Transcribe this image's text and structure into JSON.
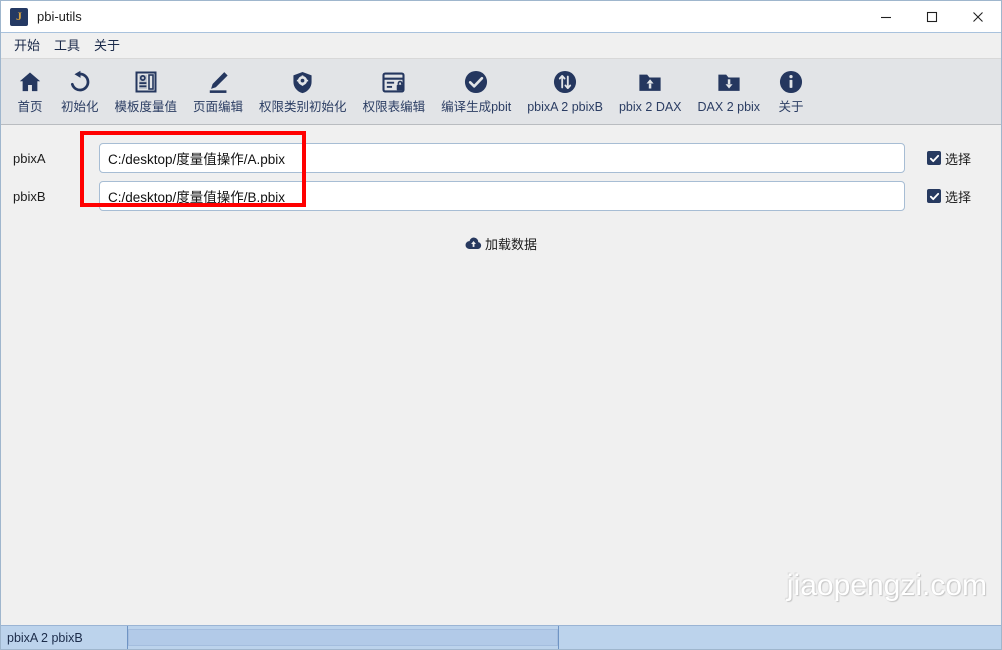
{
  "window": {
    "title": "pbi-utils",
    "app_icon_letter": "J",
    "controls": {
      "minimize": "minimize-icon",
      "maximize": "maximize-icon",
      "close": "close-icon"
    }
  },
  "menubar": {
    "items": [
      {
        "label": "开始",
        "name": "menu-start"
      },
      {
        "label": "工具",
        "name": "menu-tools"
      },
      {
        "label": "关于",
        "name": "menu-about"
      }
    ]
  },
  "toolbar": {
    "buttons": [
      {
        "label": "首页",
        "icon": "home-icon",
        "name": "toolbar-home"
      },
      {
        "label": "初始化",
        "icon": "refresh-icon",
        "name": "toolbar-initialize"
      },
      {
        "label": "模板度量值",
        "icon": "template-measure-icon",
        "name": "toolbar-template-measure"
      },
      {
        "label": "页面编辑",
        "icon": "pencil-edit-icon",
        "name": "toolbar-page-edit"
      },
      {
        "label": "权限类别初始化",
        "icon": "shield-gear-icon",
        "name": "toolbar-permission-category-init"
      },
      {
        "label": "权限表编辑",
        "icon": "table-lock-icon",
        "name": "toolbar-permission-table-edit"
      },
      {
        "label": "编译生成pbit",
        "icon": "check-circle-icon",
        "name": "toolbar-compile-pbit"
      },
      {
        "label": "pbixA 2 pbixB",
        "icon": "swap-arrows-circle-icon",
        "name": "toolbar-pbixa-2-pbixb"
      },
      {
        "label": "pbix 2 DAX",
        "icon": "folder-upload-icon",
        "name": "toolbar-pbix-2-dax"
      },
      {
        "label": "DAX 2 pbix",
        "icon": "folder-download-icon",
        "name": "toolbar-dax-2-pbix"
      },
      {
        "label": "关于",
        "icon": "info-circle-icon",
        "name": "toolbar-about"
      }
    ]
  },
  "main": {
    "fields": [
      {
        "label": "pbixA",
        "value": "C:/desktop/度量值操作/A.pbix",
        "placeholder": "",
        "checkbox_label": "选择",
        "checked": true
      },
      {
        "label": "pbixB",
        "value": "C:/desktop/度量值操作/B.pbix",
        "placeholder": "",
        "checkbox_label": "选择",
        "checked": true
      }
    ],
    "load_button": {
      "label": "加载数据",
      "icon": "cloud-upload-icon"
    },
    "annotation": {
      "type": "red-rectangle-highlight",
      "color": "#ff0000"
    },
    "watermark": "jiaopengzi.com"
  },
  "statusbar": {
    "mode_label": "pbixA 2 pbixB",
    "progress_value": ""
  },
  "colors": {
    "accent": "#25375f",
    "toolbar_bg": "#e2e4e7",
    "body_bg": "#f0f0f0",
    "statusbar_bg": "#bcd3ec",
    "annotation_red": "#ff0000",
    "checkbox_fill": "#273a60",
    "input_border": "#a7bdd4",
    "app_icon_bg": "#243963",
    "app_icon_fg": "#d9a441"
  }
}
